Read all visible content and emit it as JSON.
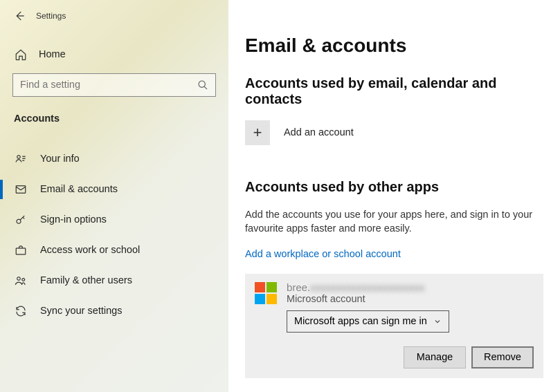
{
  "window": {
    "title": "Settings"
  },
  "sidebar": {
    "home": "Home",
    "search_placeholder": "Find a setting",
    "section_header": "Accounts",
    "items": [
      {
        "label": "Your info"
      },
      {
        "label": "Email & accounts"
      },
      {
        "label": "Sign-in options"
      },
      {
        "label": "Access work or school"
      },
      {
        "label": "Family & other users"
      },
      {
        "label": "Sync your settings"
      }
    ]
  },
  "main": {
    "page_title": "Email & accounts",
    "subhead1": "Accounts used by email, calendar and contacts",
    "add_account": "Add an account",
    "subhead2": "Accounts used by other apps",
    "other_apps_desc": "Add the accounts you use for your apps here, and sign in to your favourite apps faster and more easily.",
    "add_workschool": "Add a workplace or school account",
    "account": {
      "email_visible": "bree.",
      "type": "Microsoft account",
      "dropdown": "Microsoft apps can sign me in"
    },
    "buttons": {
      "manage": "Manage",
      "remove": "Remove"
    }
  }
}
